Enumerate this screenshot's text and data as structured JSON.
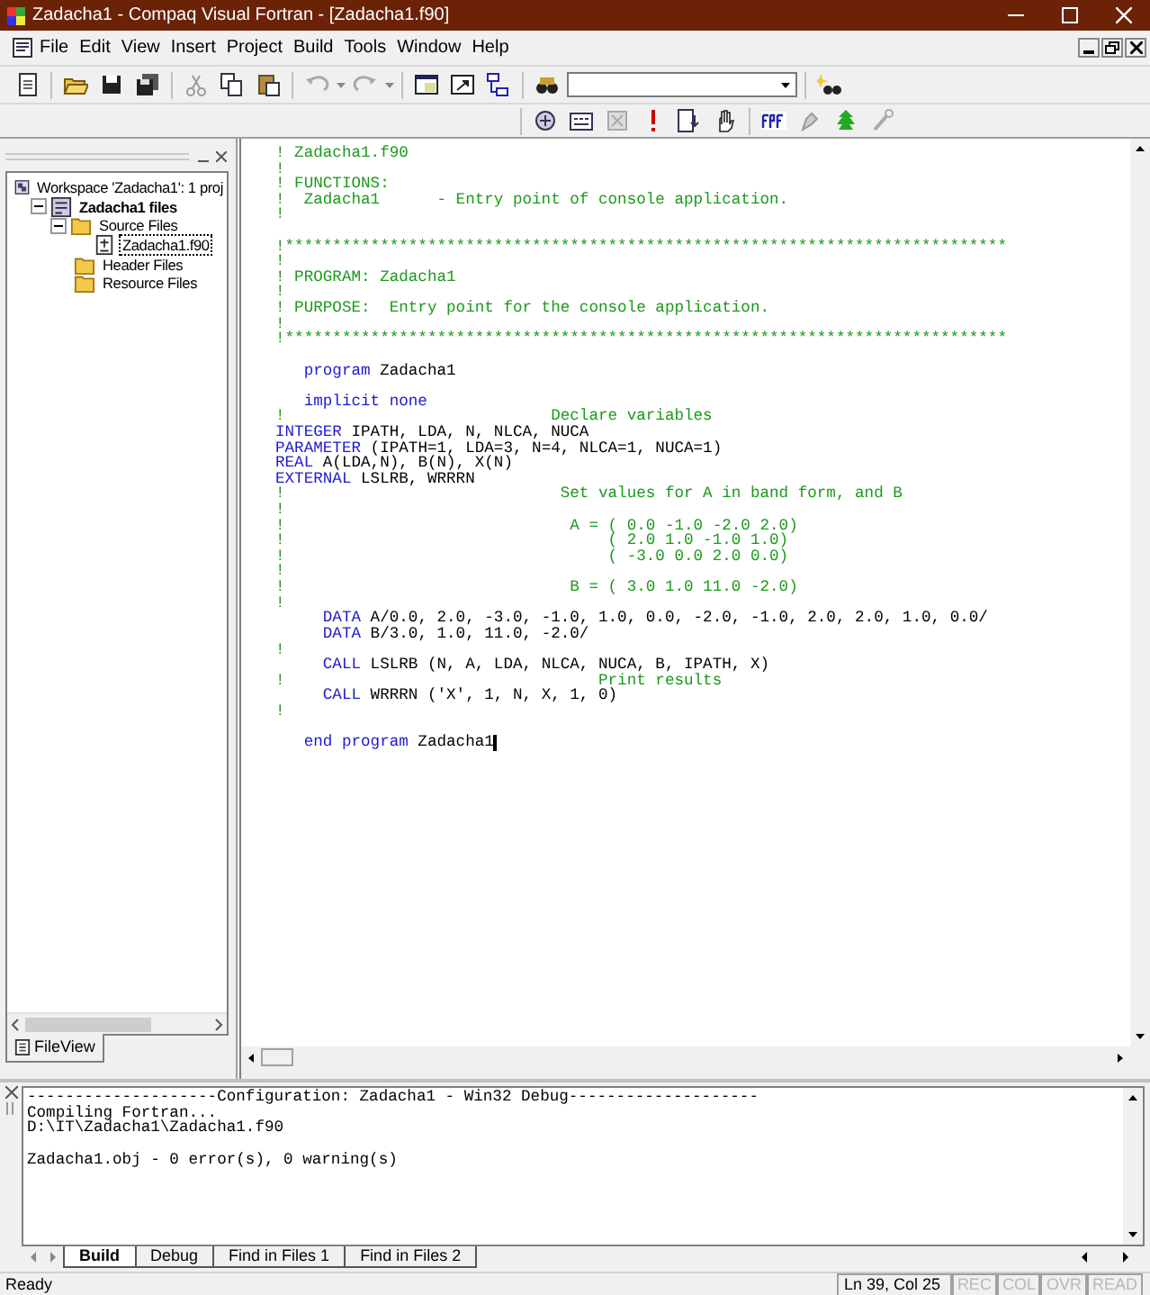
{
  "window": {
    "title": "Zadacha1 - Compaq Visual Fortran - [Zadacha1.f90]"
  },
  "menu": [
    "File",
    "Edit",
    "View",
    "Insert",
    "Project",
    "Build",
    "Tools",
    "Window",
    "Help"
  ],
  "workspace": {
    "tree": [
      {
        "kind": "workspace",
        "label": "Workspace 'Zadacha1': 1 proj",
        "selected": false,
        "children": [
          {
            "kind": "project",
            "label": "Zadacha1 files",
            "selected": false,
            "expanded": true,
            "children": [
              {
                "kind": "folder",
                "label": "Source Files",
                "selected": false,
                "expanded": true,
                "children": [
                  {
                    "kind": "file",
                    "label": "Zadacha1.f90",
                    "selected": true
                  }
                ]
              },
              {
                "kind": "folder",
                "label": "Header Files",
                "selected": false
              },
              {
                "kind": "folder",
                "label": "Resource Files",
                "selected": false
              }
            ]
          }
        ]
      }
    ],
    "tabs": [
      {
        "label": "FileView",
        "selected": true
      }
    ]
  },
  "editor": {
    "lines": [
      {
        "kind": "comment",
        "text": "! Zadacha1.f90"
      },
      {
        "kind": "comment",
        "text": "!"
      },
      {
        "kind": "comment",
        "text": "! FUNCTIONS:"
      },
      {
        "kind": "comment",
        "text": "!  Zadacha1      - Entry point of console application."
      },
      {
        "kind": "comment",
        "text": "!"
      },
      {
        "kind": "blank"
      },
      {
        "kind": "comment",
        "text": "!****************************************************************************"
      },
      {
        "kind": "comment",
        "text": "!"
      },
      {
        "kind": "comment",
        "text": "! PROGRAM: Zadacha1"
      },
      {
        "kind": "comment",
        "text": "!"
      },
      {
        "kind": "comment",
        "text": "! PURPOSE:  Entry point for the console application."
      },
      {
        "kind": "comment",
        "text": "!"
      },
      {
        "kind": "comment",
        "text": "!****************************************************************************"
      },
      {
        "kind": "blank"
      },
      {
        "kind": "code",
        "parts": [
          {
            "kind": "keyword",
            "text": "   program"
          },
          {
            "kind": "plain",
            "text": " Zadacha1"
          }
        ]
      },
      {
        "kind": "blank"
      },
      {
        "kind": "code",
        "parts": [
          {
            "kind": "keyword",
            "text": "   implicit none"
          }
        ]
      },
      {
        "kind": "comment",
        "text": "!                            Declare variables"
      },
      {
        "kind": "code",
        "parts": [
          {
            "kind": "keyword",
            "text": "INTEGER"
          },
          {
            "kind": "plain",
            "text": " IPATH, LDA, N, NLCA, NUCA"
          }
        ]
      },
      {
        "kind": "code",
        "parts": [
          {
            "kind": "keyword",
            "text": "PARAMETER"
          },
          {
            "kind": "plain",
            "text": " (IPATH=1, LDA=3, N=4, NLCA=1, NUCA=1)"
          }
        ]
      },
      {
        "kind": "code",
        "parts": [
          {
            "kind": "keyword",
            "text": "REAL"
          },
          {
            "kind": "plain",
            "text": " A(LDA,N), B(N), X(N)"
          }
        ]
      },
      {
        "kind": "code",
        "parts": [
          {
            "kind": "keyword",
            "text": "EXTERNAL"
          },
          {
            "kind": "plain",
            "text": " LSLRB, WRRRN"
          }
        ]
      },
      {
        "kind": "comment",
        "text": "!                             Set values for A in band form, and B"
      },
      {
        "kind": "comment",
        "text": "!"
      },
      {
        "kind": "comment",
        "text": "!                              A = ( 0.0 -1.0 -2.0 2.0)"
      },
      {
        "kind": "comment",
        "text": "!                                  ( 2.0 1.0 -1.0 1.0)"
      },
      {
        "kind": "comment",
        "text": "!                                  ( -3.0 0.0 2.0 0.0)"
      },
      {
        "kind": "comment",
        "text": "!"
      },
      {
        "kind": "comment",
        "text": "!                              B = ( 3.0 1.0 11.0 -2.0)"
      },
      {
        "kind": "comment",
        "text": "!"
      },
      {
        "kind": "code",
        "parts": [
          {
            "kind": "keyword",
            "text": "     DATA"
          },
          {
            "kind": "plain",
            "text": " A/0.0, 2.0, -3.0, -1.0, 1.0, 0.0, -2.0, -1.0, 2.0, 2.0, 1.0, 0.0/"
          }
        ]
      },
      {
        "kind": "code",
        "parts": [
          {
            "kind": "keyword",
            "text": "     DATA"
          },
          {
            "kind": "plain",
            "text": " B/3.0, 1.0, 11.0, -2.0/"
          }
        ]
      },
      {
        "kind": "comment",
        "text": "!"
      },
      {
        "kind": "code",
        "parts": [
          {
            "kind": "keyword",
            "text": "     CALL"
          },
          {
            "kind": "plain",
            "text": " LSLRB (N, A, LDA, NLCA, NUCA, B, IPATH, X)"
          }
        ]
      },
      {
        "kind": "comment",
        "text": "!                                 Print results"
      },
      {
        "kind": "code",
        "parts": [
          {
            "kind": "keyword",
            "text": "     CALL"
          },
          {
            "kind": "plain",
            "text": " WRRRN ('X', 1, N, X, 1, 0)"
          }
        ]
      },
      {
        "kind": "comment",
        "text": "!"
      },
      {
        "kind": "blank"
      },
      {
        "kind": "code",
        "caret": true,
        "parts": [
          {
            "kind": "keyword",
            "text": "   end program"
          },
          {
            "kind": "plain",
            "text": " Zadacha1"
          }
        ]
      }
    ]
  },
  "output": {
    "blocks": [
      [
        "--------------------Configuration: Zadacha1 - Win32 Debug--------------------",
        "Compiling Fortran...",
        "D:\\IT\\Zadacha1\\Zadacha1.f90"
      ],
      [
        "Zadacha1.obj - 0 error(s), 0 warning(s)"
      ]
    ],
    "tabs": [
      {
        "label": "Build",
        "selected": true
      },
      {
        "label": "Debug",
        "selected": false
      },
      {
        "label": "Find in Files 1",
        "selected": false
      },
      {
        "label": "Find in Files 2",
        "selected": false
      }
    ]
  },
  "status_bar": {
    "message": "Ready",
    "position": "Ln 39, Col 25",
    "indicators": [
      {
        "label": "REC",
        "on": false
      },
      {
        "label": "COL",
        "on": false
      },
      {
        "label": "OVR",
        "on": false
      },
      {
        "label": "READ",
        "on": false
      }
    ]
  }
}
